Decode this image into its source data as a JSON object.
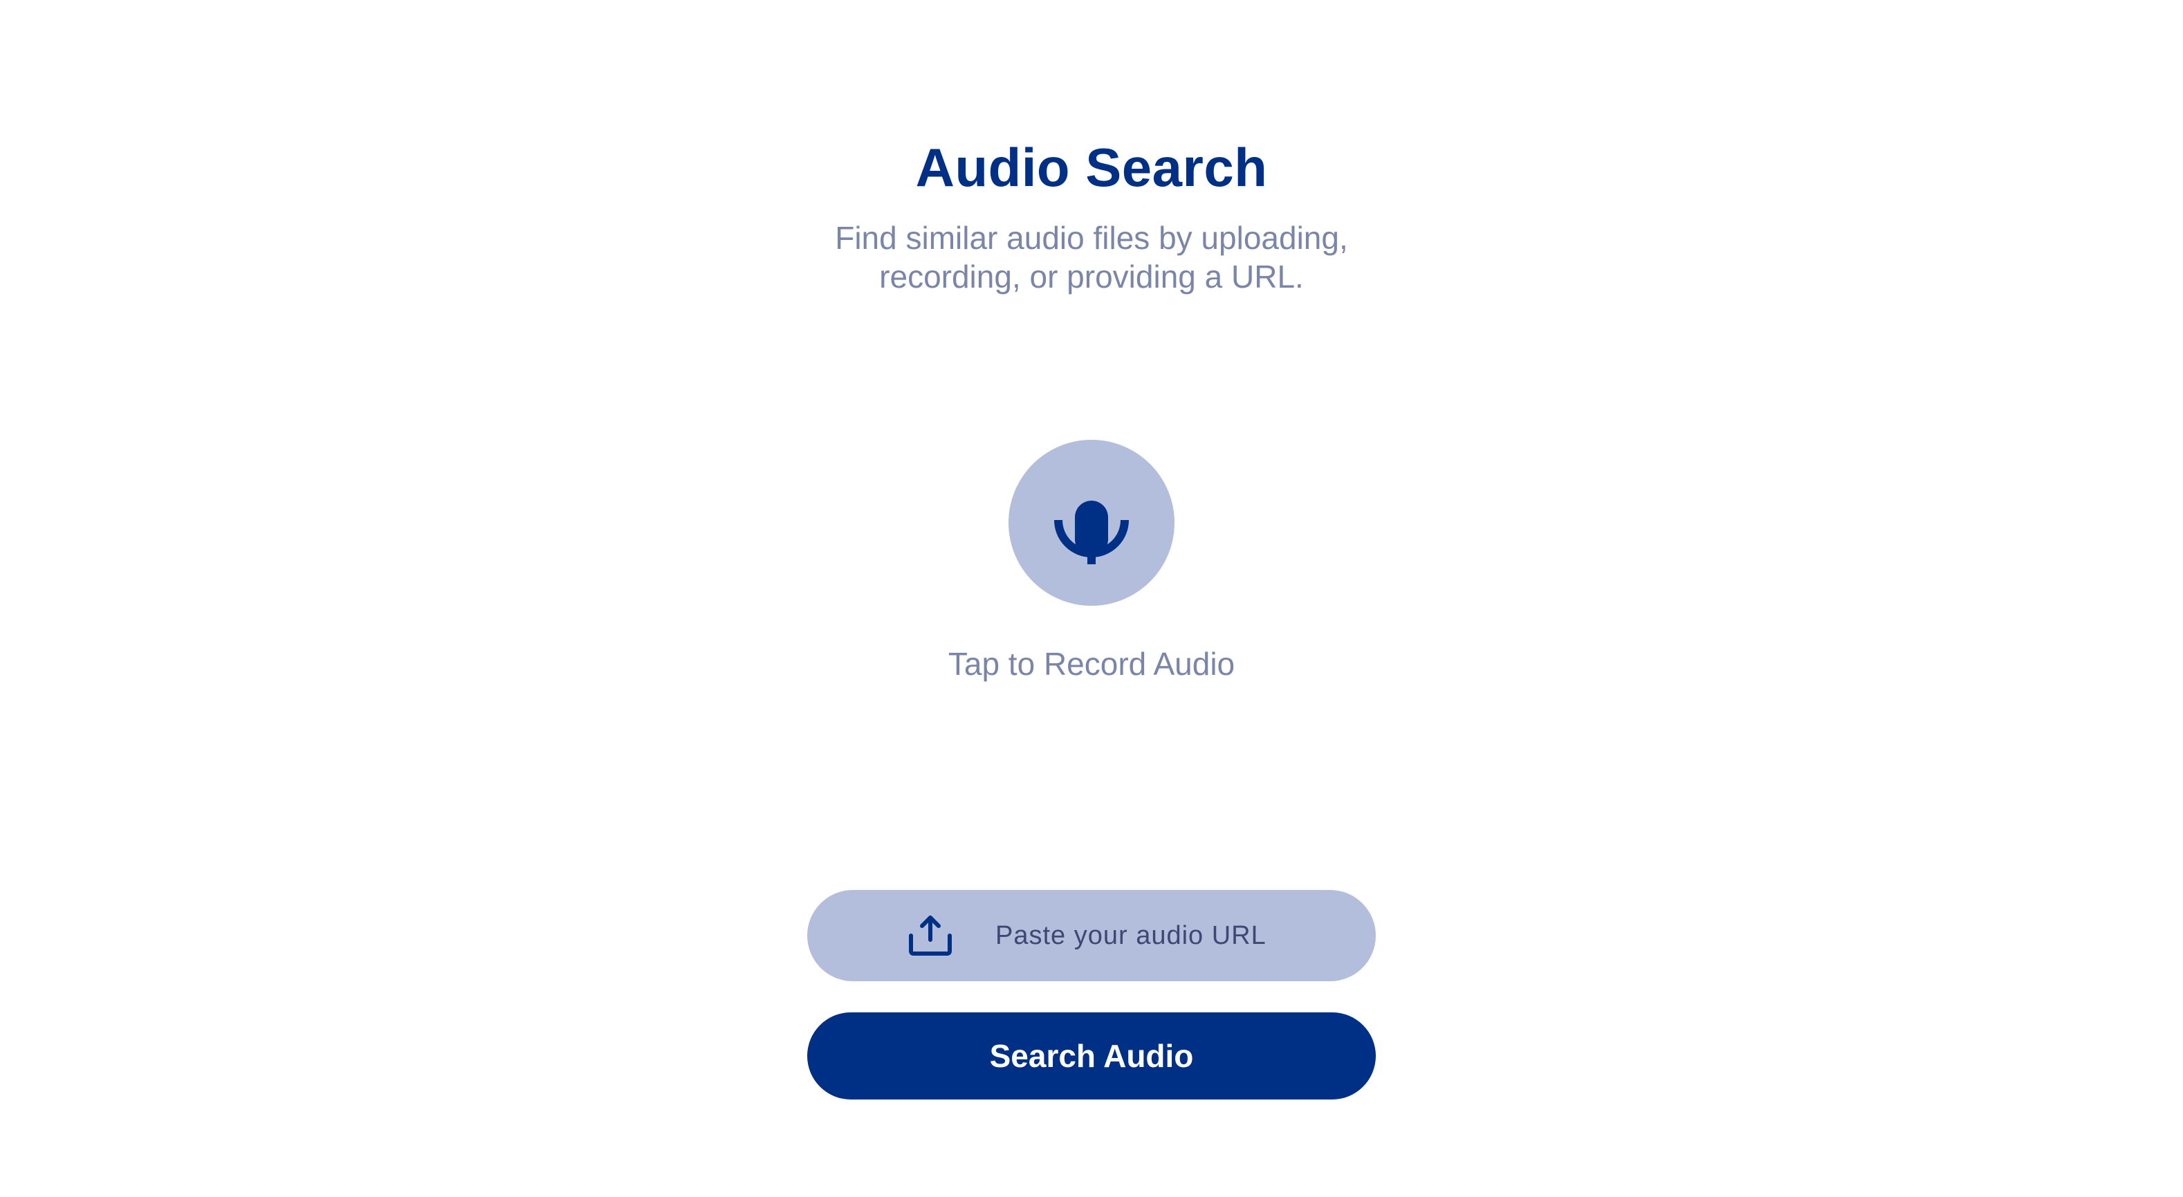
{
  "header": {
    "title": "Audio Search",
    "subtitle": "Find similar audio files by uploading, recording, or providing a URL."
  },
  "recorder": {
    "icon": "microphone-icon",
    "label": "Tap to Record Audio"
  },
  "url_input": {
    "icon": "upload-icon",
    "value": "",
    "placeholder": "Paste your audio URL"
  },
  "actions": {
    "search_label": "Search Audio"
  },
  "colors": {
    "primary": "#002f86",
    "primary_light": "#b3bedc",
    "muted_text": "#7a85a8",
    "background": "#ffffff"
  }
}
